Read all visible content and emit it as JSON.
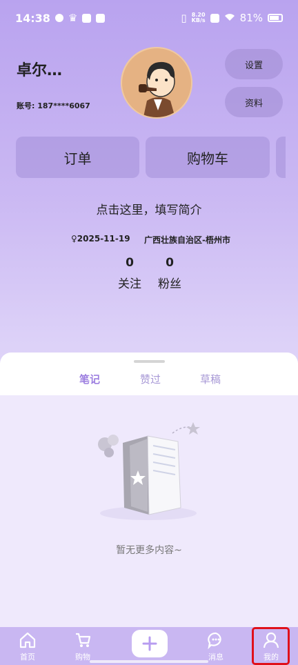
{
  "status_bar": {
    "time": "14:38",
    "net_speed_value": "8.20",
    "net_speed_unit": "KB/s",
    "battery": "81%"
  },
  "profile": {
    "name": "卓尔…",
    "account": "账号: 187****6067",
    "bio_placeholder": "点击这里，填写简介",
    "birthday": "2025-11-19",
    "location": "广西壮族自治区-梧州市"
  },
  "buttons": {
    "settings": "设置",
    "profile_info": "资料",
    "orders": "订单",
    "cart": "购物车"
  },
  "stats": {
    "following_count": "0",
    "following_label": "关注",
    "fans_count": "0",
    "fans_label": "粉丝"
  },
  "content_tabs": [
    {
      "label": "笔记",
      "active": true
    },
    {
      "label": "赞过",
      "active": false
    },
    {
      "label": "草稿",
      "active": false
    }
  ],
  "empty_state": {
    "text": "暂无更多内容~"
  },
  "bottom_nav": [
    {
      "label": "首页",
      "icon": "home-icon"
    },
    {
      "label": "购物",
      "icon": "cart-icon"
    },
    {
      "label": "",
      "icon": "plus-icon"
    },
    {
      "label": "消息",
      "icon": "message-icon"
    },
    {
      "label": "我的",
      "icon": "user-icon",
      "active": true
    }
  ],
  "colors": {
    "accent": "#9d7fe0",
    "highlight_box": "#e0101a",
    "tabbar_bg": "#c9b7f2"
  }
}
